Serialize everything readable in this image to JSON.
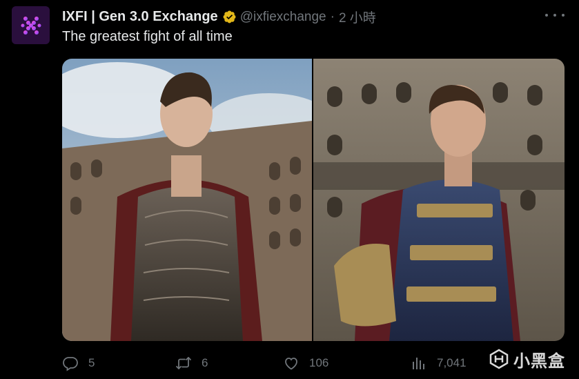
{
  "tweet": {
    "display_name": "IXFI | Gen 3.0 Exchange",
    "handle": "@ixfiexchange",
    "separator": "·",
    "time": "2 小時",
    "text": "The greatest fight of all time",
    "verified_icon": "verified-badge-icon",
    "avatar_icon": "ixfi-logo-icon"
  },
  "media": {
    "panels": [
      {
        "icon": "gladiator-image-left"
      },
      {
        "icon": "gladiator-image-right"
      }
    ]
  },
  "actions": {
    "reply_count": "5",
    "repost_count": "6",
    "like_count": "106",
    "view_count": "7,041"
  },
  "watermark": {
    "text": "小黑盒",
    "logo_icon": "xiaoheihe-logo-icon"
  },
  "colors": {
    "background": "#000000",
    "text": "#e7e9ea",
    "muted": "#71767b",
    "verified_gold": "#e2b719",
    "avatar_bg": "#2a0f3d"
  }
}
